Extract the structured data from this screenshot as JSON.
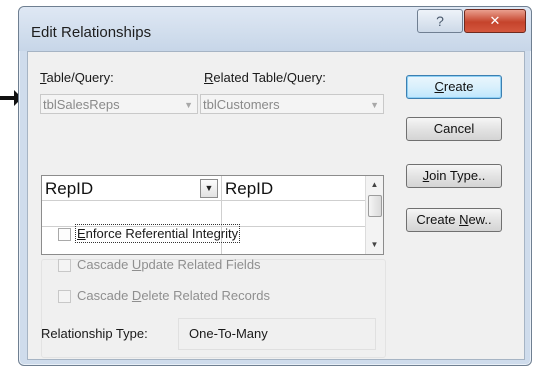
{
  "dialog": {
    "title": "Edit Relationships",
    "help_glyph": "?",
    "close_glyph": "✕"
  },
  "labels": {
    "table_query_u": "T",
    "table_query_rest": "able/Query:",
    "related_u": "R",
    "related_rest": "elated Table/Query:"
  },
  "combos": {
    "table": "tblSalesReps",
    "related": "tblCustomers"
  },
  "grid": {
    "rows": [
      {
        "left": "RepID",
        "right": "RepID"
      },
      {
        "left": "",
        "right": ""
      },
      {
        "left": "",
        "right": ""
      }
    ]
  },
  "options": {
    "enforce_u": "E",
    "enforce_rest": "nforce Referential Integrity",
    "cascade_update_a": "Cascade ",
    "cascade_update_u": "U",
    "cascade_update_b": "pdate Related Fields",
    "cascade_delete_a": "Cascade ",
    "cascade_delete_u": "D",
    "cascade_delete_b": "elete Related Records"
  },
  "buttons": {
    "create_u": "C",
    "create_rest": "reate",
    "cancel": "Cancel",
    "join_u": "J",
    "join_rest": "oin Type..",
    "createnew_a": "Create ",
    "createnew_u": "N",
    "createnew_b": "ew.."
  },
  "relationship": {
    "label": "Relationship Type:",
    "value": "One-To-Many"
  }
}
